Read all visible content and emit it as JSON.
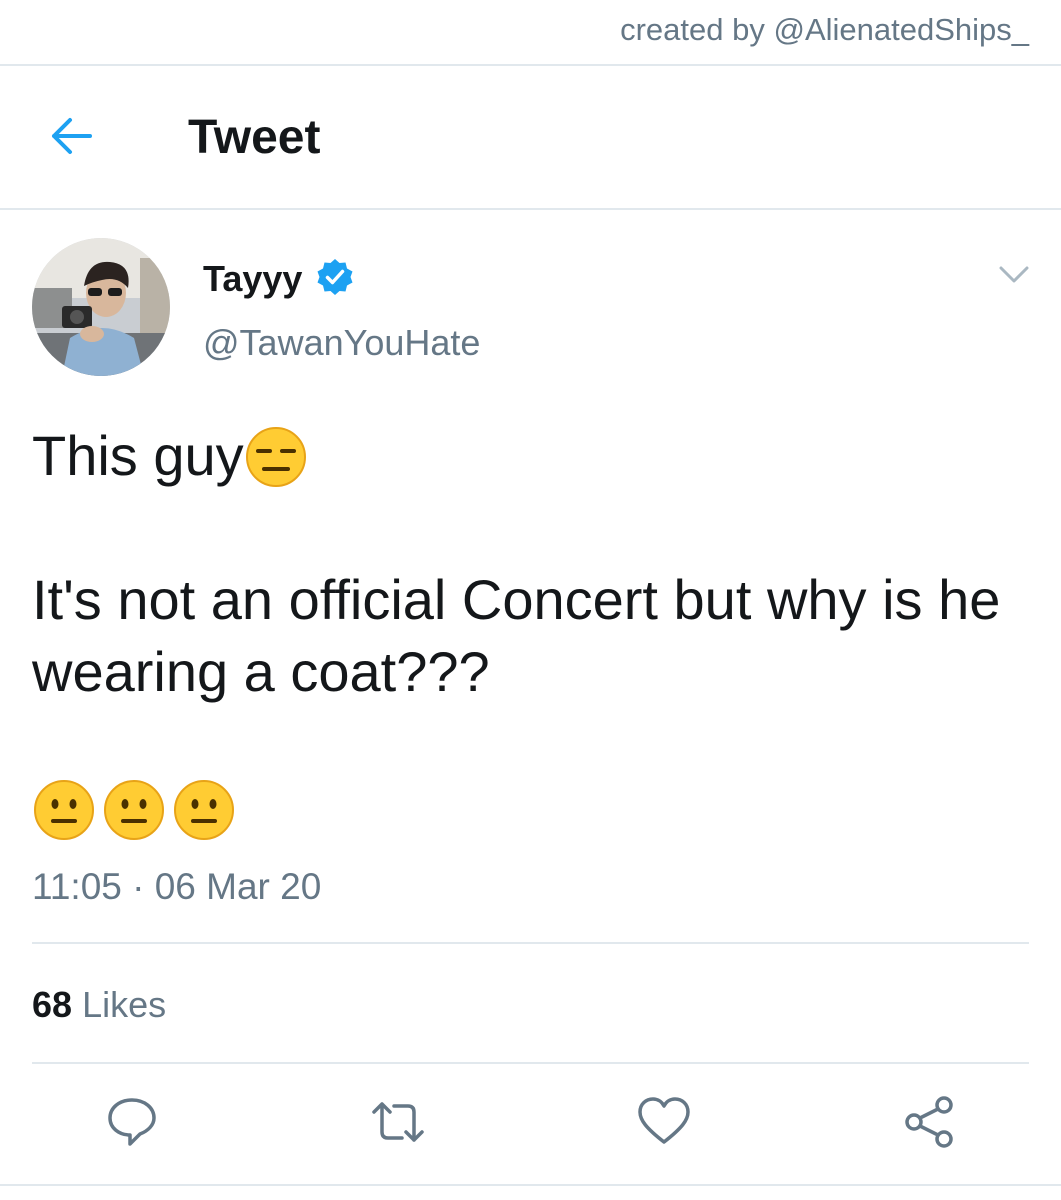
{
  "watermark": "created by @AlienatedShips_",
  "header": {
    "title": "Tweet",
    "back_icon": "arrow-left-icon",
    "accent_color": "#1da1f2"
  },
  "author": {
    "display_name": "Tayyy",
    "handle": "@TawanYouHate",
    "verified": true,
    "verified_icon": "verified-badge-icon"
  },
  "tweet": {
    "line1_text": "This guy",
    "line1_emoji": "expressionless-face-emoji",
    "line2_text": "It's not an official Concert but why is he wearing a coat???",
    "emoji_row": [
      "neutral-face-emoji",
      "neutral-face-emoji",
      "neutral-face-emoji"
    ],
    "timestamp": "11:05 · 06 Mar 20"
  },
  "stats": {
    "likes_count": "68",
    "likes_label": "Likes"
  },
  "actions": [
    {
      "name": "reply",
      "icon": "reply-icon"
    },
    {
      "name": "retweet",
      "icon": "retweet-icon"
    },
    {
      "name": "like",
      "icon": "heart-icon"
    },
    {
      "name": "share",
      "icon": "share-icon"
    }
  ],
  "colors": {
    "text_primary": "#14171a",
    "text_secondary": "#657786",
    "divider": "#e1e8ed",
    "verified": "#1da1f2"
  }
}
